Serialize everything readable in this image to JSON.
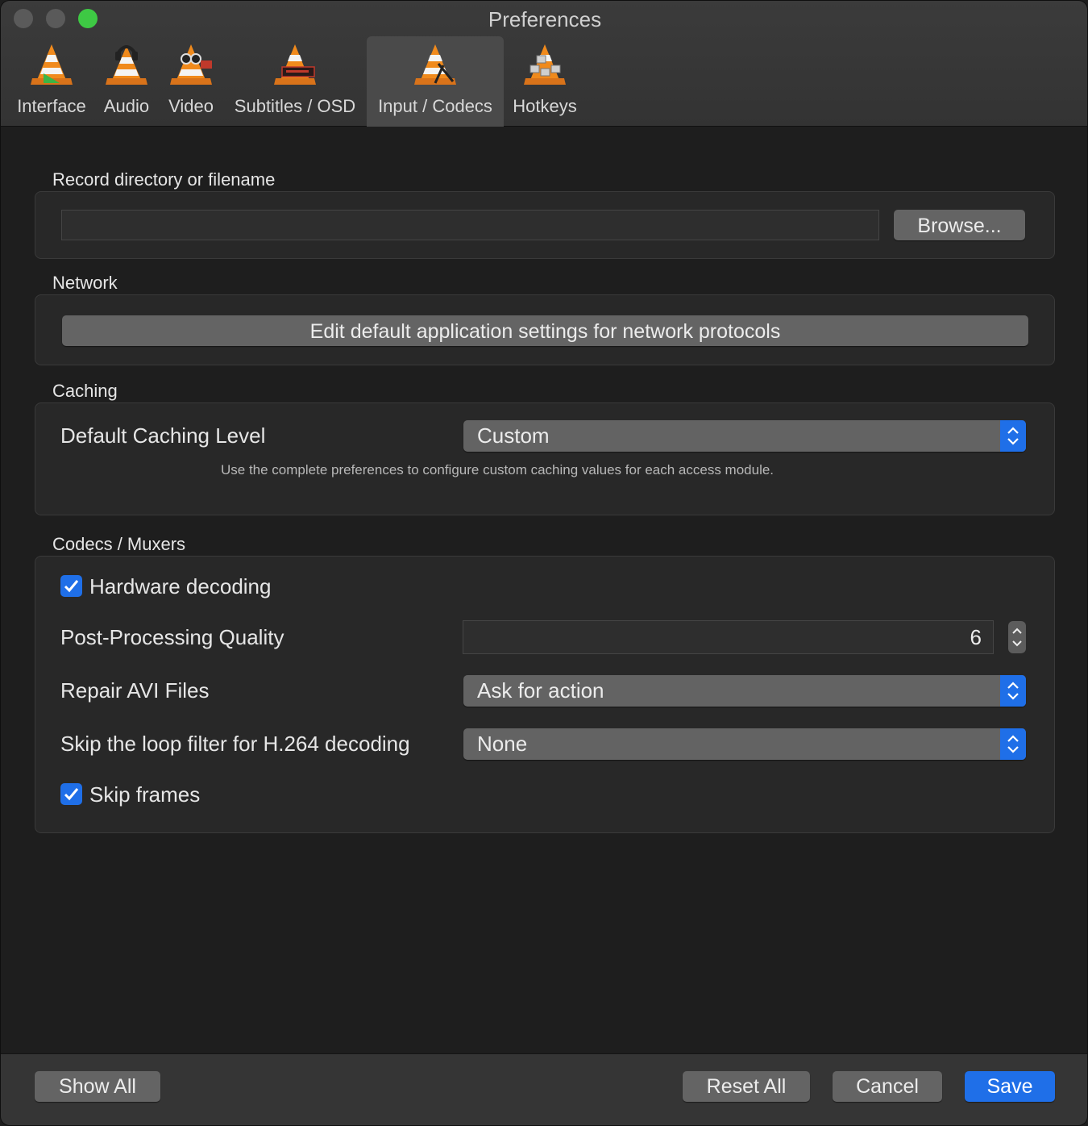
{
  "window": {
    "title": "Preferences"
  },
  "tabs": [
    {
      "label": "Interface",
      "icon": "vlc-cone-interface-icon"
    },
    {
      "label": "Audio",
      "icon": "vlc-cone-audio-icon"
    },
    {
      "label": "Video",
      "icon": "vlc-cone-video-icon"
    },
    {
      "label": "Subtitles / OSD",
      "icon": "vlc-cone-subtitles-icon"
    },
    {
      "label": "Input / Codecs",
      "icon": "vlc-cone-input-icon",
      "active": true
    },
    {
      "label": "Hotkeys",
      "icon": "vlc-cone-hotkeys-icon"
    }
  ],
  "record": {
    "section_title": "Record directory or filename",
    "path_value": "",
    "browse_label": "Browse..."
  },
  "network": {
    "section_title": "Network",
    "edit_button_label": "Edit default application settings for network protocols"
  },
  "caching": {
    "section_title": "Caching",
    "level_label": "Default Caching Level",
    "level_value": "Custom",
    "hint": "Use the complete preferences to configure custom caching values for each access module."
  },
  "codecs": {
    "section_title": "Codecs / Muxers",
    "hardware_decoding_label": "Hardware decoding",
    "hardware_decoding_checked": true,
    "post_processing_label": "Post-Processing Quality",
    "post_processing_value": "6",
    "repair_avi_label": "Repair AVI Files",
    "repair_avi_value": "Ask for action",
    "skip_loop_label": "Skip the loop filter for H.264 decoding",
    "skip_loop_value": "None",
    "skip_frames_label": "Skip frames",
    "skip_frames_checked": true
  },
  "footer": {
    "show_all_label": "Show All",
    "reset_all_label": "Reset All",
    "cancel_label": "Cancel",
    "save_label": "Save"
  },
  "colors": {
    "accent": "#1f6fe8",
    "zoom_button": "#3ec944",
    "background": "#1e1e1e",
    "cone_orange": "#f08a1c"
  }
}
